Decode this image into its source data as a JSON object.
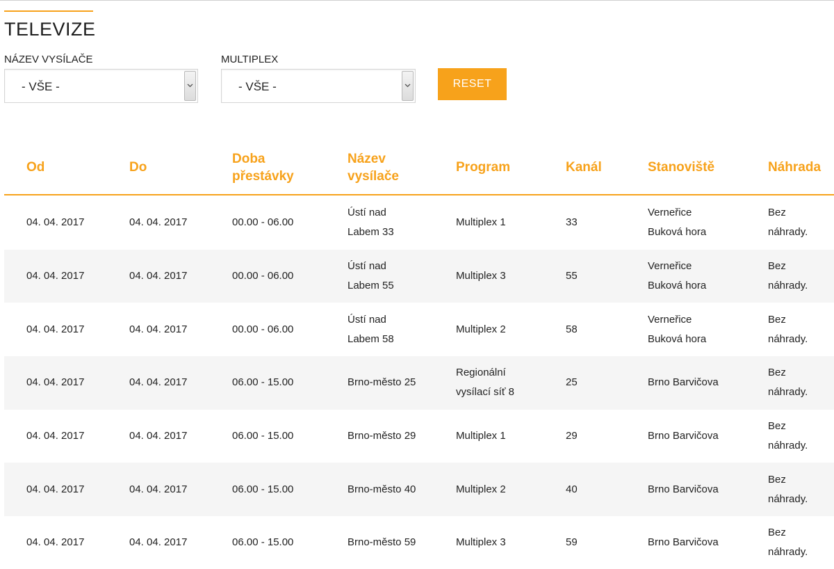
{
  "page": {
    "title": "TELEVIZE"
  },
  "filters": {
    "transmitter_label": "NÁZEV VYSÍLAČE",
    "transmitter_value": "- VŠE -",
    "multiplex_label": "MULTIPLEX",
    "multiplex_value": "- VŠE -",
    "reset_label": "RESET"
  },
  "colors": {
    "accent": "#f7a21b",
    "row_alt": "#f5f5f5"
  },
  "table": {
    "headers": {
      "od": "Od",
      "do": "Do",
      "doba": "Doba přestávky",
      "nazev": "Název vysílače",
      "program": "Program",
      "kanal": "Kanál",
      "stanoviste": "Stanoviště",
      "nahrada": "Náhrada"
    },
    "rows": [
      {
        "od": "04. 04. 2017",
        "do": "04. 04. 2017",
        "doba": "00.00 - 06.00",
        "nazev": "Ústí nad Labem 33",
        "program": "Multiplex 1",
        "kanal": "33",
        "stanoviste": "Verneřice Buková hora",
        "nahrada": "Bez náhrady."
      },
      {
        "od": "04. 04. 2017",
        "do": "04. 04. 2017",
        "doba": "00.00 - 06.00",
        "nazev": "Ústí nad Labem 55",
        "program": "Multiplex 3",
        "kanal": "55",
        "stanoviste": "Verneřice Buková hora",
        "nahrada": "Bez náhrady."
      },
      {
        "od": "04. 04. 2017",
        "do": "04. 04. 2017",
        "doba": "00.00 - 06.00",
        "nazev": "Ústí nad Labem 58",
        "program": "Multiplex 2",
        "kanal": "58",
        "stanoviste": "Verneřice Buková hora",
        "nahrada": "Bez náhrady."
      },
      {
        "od": "04. 04. 2017",
        "do": "04. 04. 2017",
        "doba": "06.00 - 15.00",
        "nazev": "Brno-město 25",
        "program": "Regionální vysílací síť 8",
        "kanal": "25",
        "stanoviste": "Brno Barvičova",
        "nahrada": "Bez náhrady."
      },
      {
        "od": "04. 04. 2017",
        "do": "04. 04. 2017",
        "doba": "06.00 - 15.00",
        "nazev": "Brno-město 29",
        "program": "Multiplex 1",
        "kanal": "29",
        "stanoviste": "Brno Barvičova",
        "nahrada": "Bez náhrady."
      },
      {
        "od": "04. 04. 2017",
        "do": "04. 04. 2017",
        "doba": "06.00 - 15.00",
        "nazev": "Brno-město 40",
        "program": "Multiplex 2",
        "kanal": "40",
        "stanoviste": "Brno Barvičova",
        "nahrada": "Bez náhrady."
      },
      {
        "od": "04. 04. 2017",
        "do": "04. 04. 2017",
        "doba": "06.00 - 15.00",
        "nazev": "Brno-město 59",
        "program": "Multiplex 3",
        "kanal": "59",
        "stanoviste": "Brno Barvičova",
        "nahrada": "Bez náhrady."
      }
    ]
  }
}
